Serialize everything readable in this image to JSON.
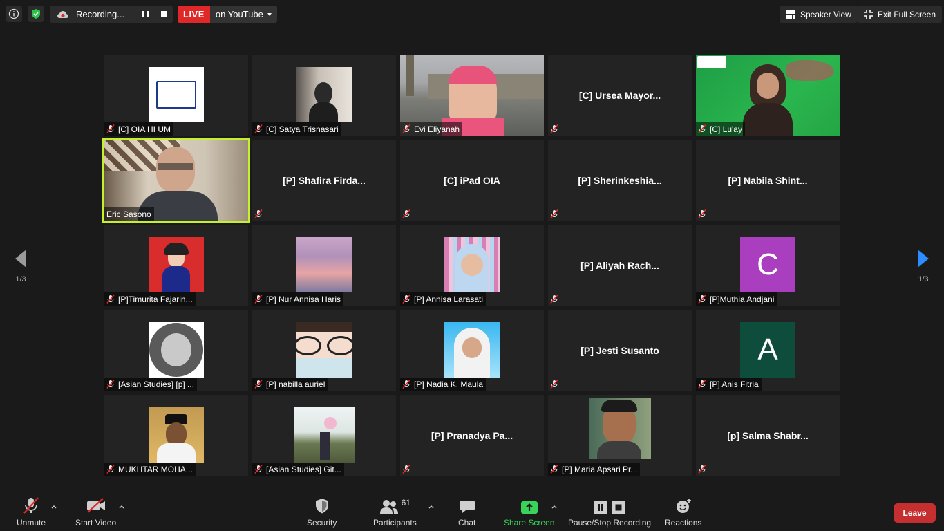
{
  "topbar": {
    "recording_label": "Recording...",
    "live_label": "LIVE",
    "live_target": "on YouTube",
    "speaker_view": "Speaker View",
    "exit_full_screen": "Exit Full Screen"
  },
  "gallery": {
    "page_left": "1/3",
    "page_right": "1/3",
    "tiles": [
      {
        "name": "[C] OIA HI UM",
        "kind": "thumb",
        "big": ""
      },
      {
        "name": "[C] Satya Trisnasari",
        "kind": "thumb",
        "big": ""
      },
      {
        "name": "Evi Eliyanah",
        "kind": "full",
        "big": ""
      },
      {
        "name": "",
        "kind": "text",
        "big": "[C]  Ursea  Mayor..."
      },
      {
        "name": "[C] Lu'ay",
        "kind": "full",
        "big": ""
      },
      {
        "name": "Eric Sasono",
        "kind": "full",
        "big": ""
      },
      {
        "name": "",
        "kind": "text",
        "big": "[P]  Shafira  Firda..."
      },
      {
        "name": "",
        "kind": "text",
        "big": "[C] iPad OIA"
      },
      {
        "name": "",
        "kind": "text",
        "big": "[P]  Sherinkeshia..."
      },
      {
        "name": "",
        "kind": "text",
        "big": "[P]  Nabila  Shint..."
      },
      {
        "name": "[P]Timurita Fajarin...",
        "kind": "thumb",
        "big": ""
      },
      {
        "name": "[P] Nur Annisa Haris",
        "kind": "thumb",
        "big": ""
      },
      {
        "name": "[P] Annisa Larasati",
        "kind": "thumb",
        "big": ""
      },
      {
        "name": "",
        "kind": "text",
        "big": "[P]  Aliyah  Rach..."
      },
      {
        "name": "[P]Muthia Andjani",
        "kind": "avatar",
        "big": "C"
      },
      {
        "name": "[Asian Studies] [p] ...",
        "kind": "thumb",
        "big": ""
      },
      {
        "name": "[P] nabilla auriel",
        "kind": "thumb",
        "big": ""
      },
      {
        "name": "[P] Nadia K. Maula",
        "kind": "thumb",
        "big": ""
      },
      {
        "name": "",
        "kind": "text",
        "big": "[P] Jesti Susanto"
      },
      {
        "name": "[P] Anis Fitria",
        "kind": "avatar",
        "big": "A"
      },
      {
        "name": "MUKHTAR MOHA...",
        "kind": "thumb",
        "big": ""
      },
      {
        "name": "[Asian Studies] Git...",
        "kind": "thumb",
        "big": ""
      },
      {
        "name": "",
        "kind": "text",
        "big": "[P]  Pranadya  Pa..."
      },
      {
        "name": "[P] Maria Apsari Pr...",
        "kind": "thumb",
        "big": ""
      },
      {
        "name": "",
        "kind": "text",
        "big": "[p]  Salma  Shabr..."
      }
    ]
  },
  "toolbar": {
    "unmute": "Unmute",
    "start_video": "Start Video",
    "security": "Security",
    "participants": "Participants",
    "participants_count": "61",
    "chat": "Chat",
    "share_screen": "Share Screen",
    "pause_stop_recording": "Pause/Stop Recording",
    "reactions": "Reactions",
    "leave": "Leave"
  },
  "colors": {
    "active_speaker": "#c5f02c",
    "live_red": "#e02828",
    "share_green": "#39d35a",
    "leave_red": "#c62f2f",
    "avatar_c": "#a93fbf",
    "avatar_a": "#0e4d3c"
  }
}
